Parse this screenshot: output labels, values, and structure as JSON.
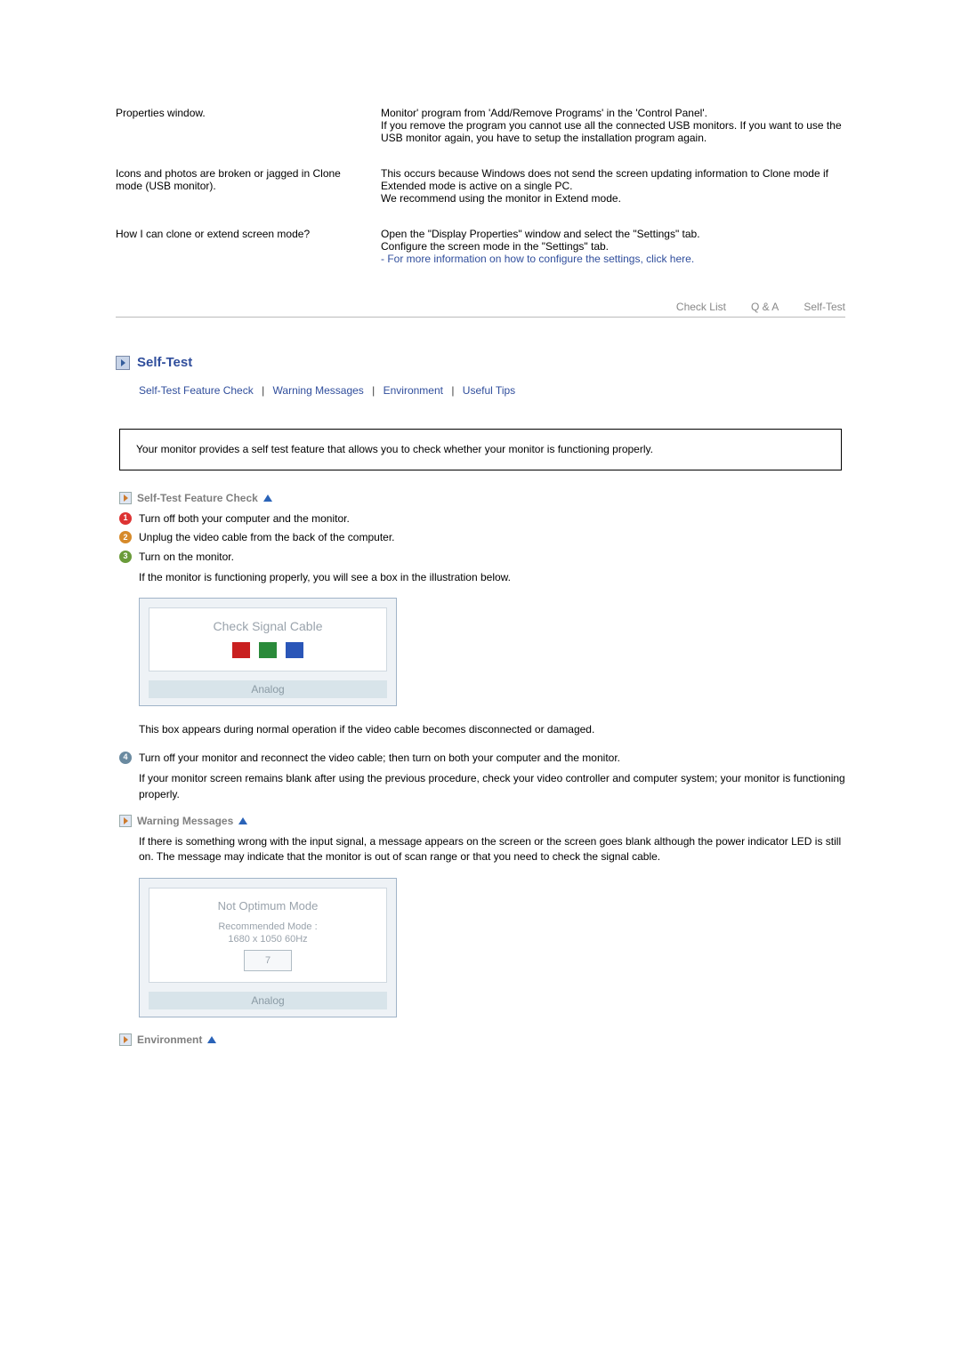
{
  "faq": [
    {
      "q": "Properties window.",
      "a": "Monitor' program from 'Add/Remove Programs' in the 'Control Panel'.\nIf you remove the program you cannot use all the connected USB monitors. If you want to use the USB monitor again, you have to setup the installation program again."
    },
    {
      "q": "Icons and photos are broken or jagged in Clone mode (USB monitor).",
      "a": "This occurs because Windows does not send the screen updating information to Clone mode if Extended mode is active on a single PC.\nWe recommend using the monitor in Extend mode."
    },
    {
      "q": "How I can clone or extend screen mode?",
      "a": "Open the \"Display Properties\" window and select the \"Settings\" tab.\nConfigure the screen mode in the \"Settings\" tab.",
      "link": "- For more information on how to configure the settings, click here."
    }
  ],
  "tabs": {
    "t1": "Check List",
    "t2": "Q & A",
    "t3": "Self-Test"
  },
  "section": {
    "title": "Self-Test"
  },
  "anchors": {
    "a1": "Self-Test Feature Check",
    "a2": "Warning Messages",
    "a3": "Environment",
    "a4": "Useful Tips"
  },
  "infobox": "Your monitor provides a self test feature that allows you to check whether your monitor is functioning properly.",
  "sub1": "Self-Test Feature Check",
  "steps1": {
    "s1": "Turn off both your computer and the monitor.",
    "s2": "Unplug the video cable from the back of the computer.",
    "s3": "Turn on the monitor.",
    "s3b": "If the monitor is functioning properly, you will see a box in the illustration below."
  },
  "signal1": {
    "title": "Check Signal Cable",
    "strip": "Analog"
  },
  "after1": "This box appears during normal operation if the video cable becomes disconnected or damaged.",
  "step4": "Turn off your monitor and reconnect the video cable; then turn on both your computer and the monitor.",
  "step4b": "If your monitor screen remains blank after using the previous procedure, check your video controller and computer system; your monitor is functioning properly.",
  "sub2": "Warning Messages",
  "warn_p": "If there is something wrong with the input signal, a message appears on the screen or the screen goes blank although the power indicator LED is still on. The message may indicate that the monitor is out of scan range or that you need to check the signal cable.",
  "signal2": {
    "title": "Not Optimum Mode",
    "sub": "Recommended Mode :",
    "res": "1680 x 1050   60Hz",
    "count": "7",
    "strip": "Analog"
  },
  "sub3": "Environment"
}
